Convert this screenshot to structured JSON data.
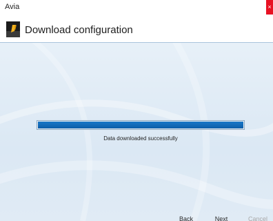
{
  "window": {
    "title": "Avia",
    "close_glyph": "×"
  },
  "header": {
    "title": "Download configuration",
    "logo_icon": "download-app-icon"
  },
  "progress": {
    "value_percent": 100,
    "status": "Data downloaded successfully",
    "color": "#0d5ea8"
  },
  "buttons": {
    "back": "Back",
    "next": "Next",
    "cancel": "Cancel"
  }
}
